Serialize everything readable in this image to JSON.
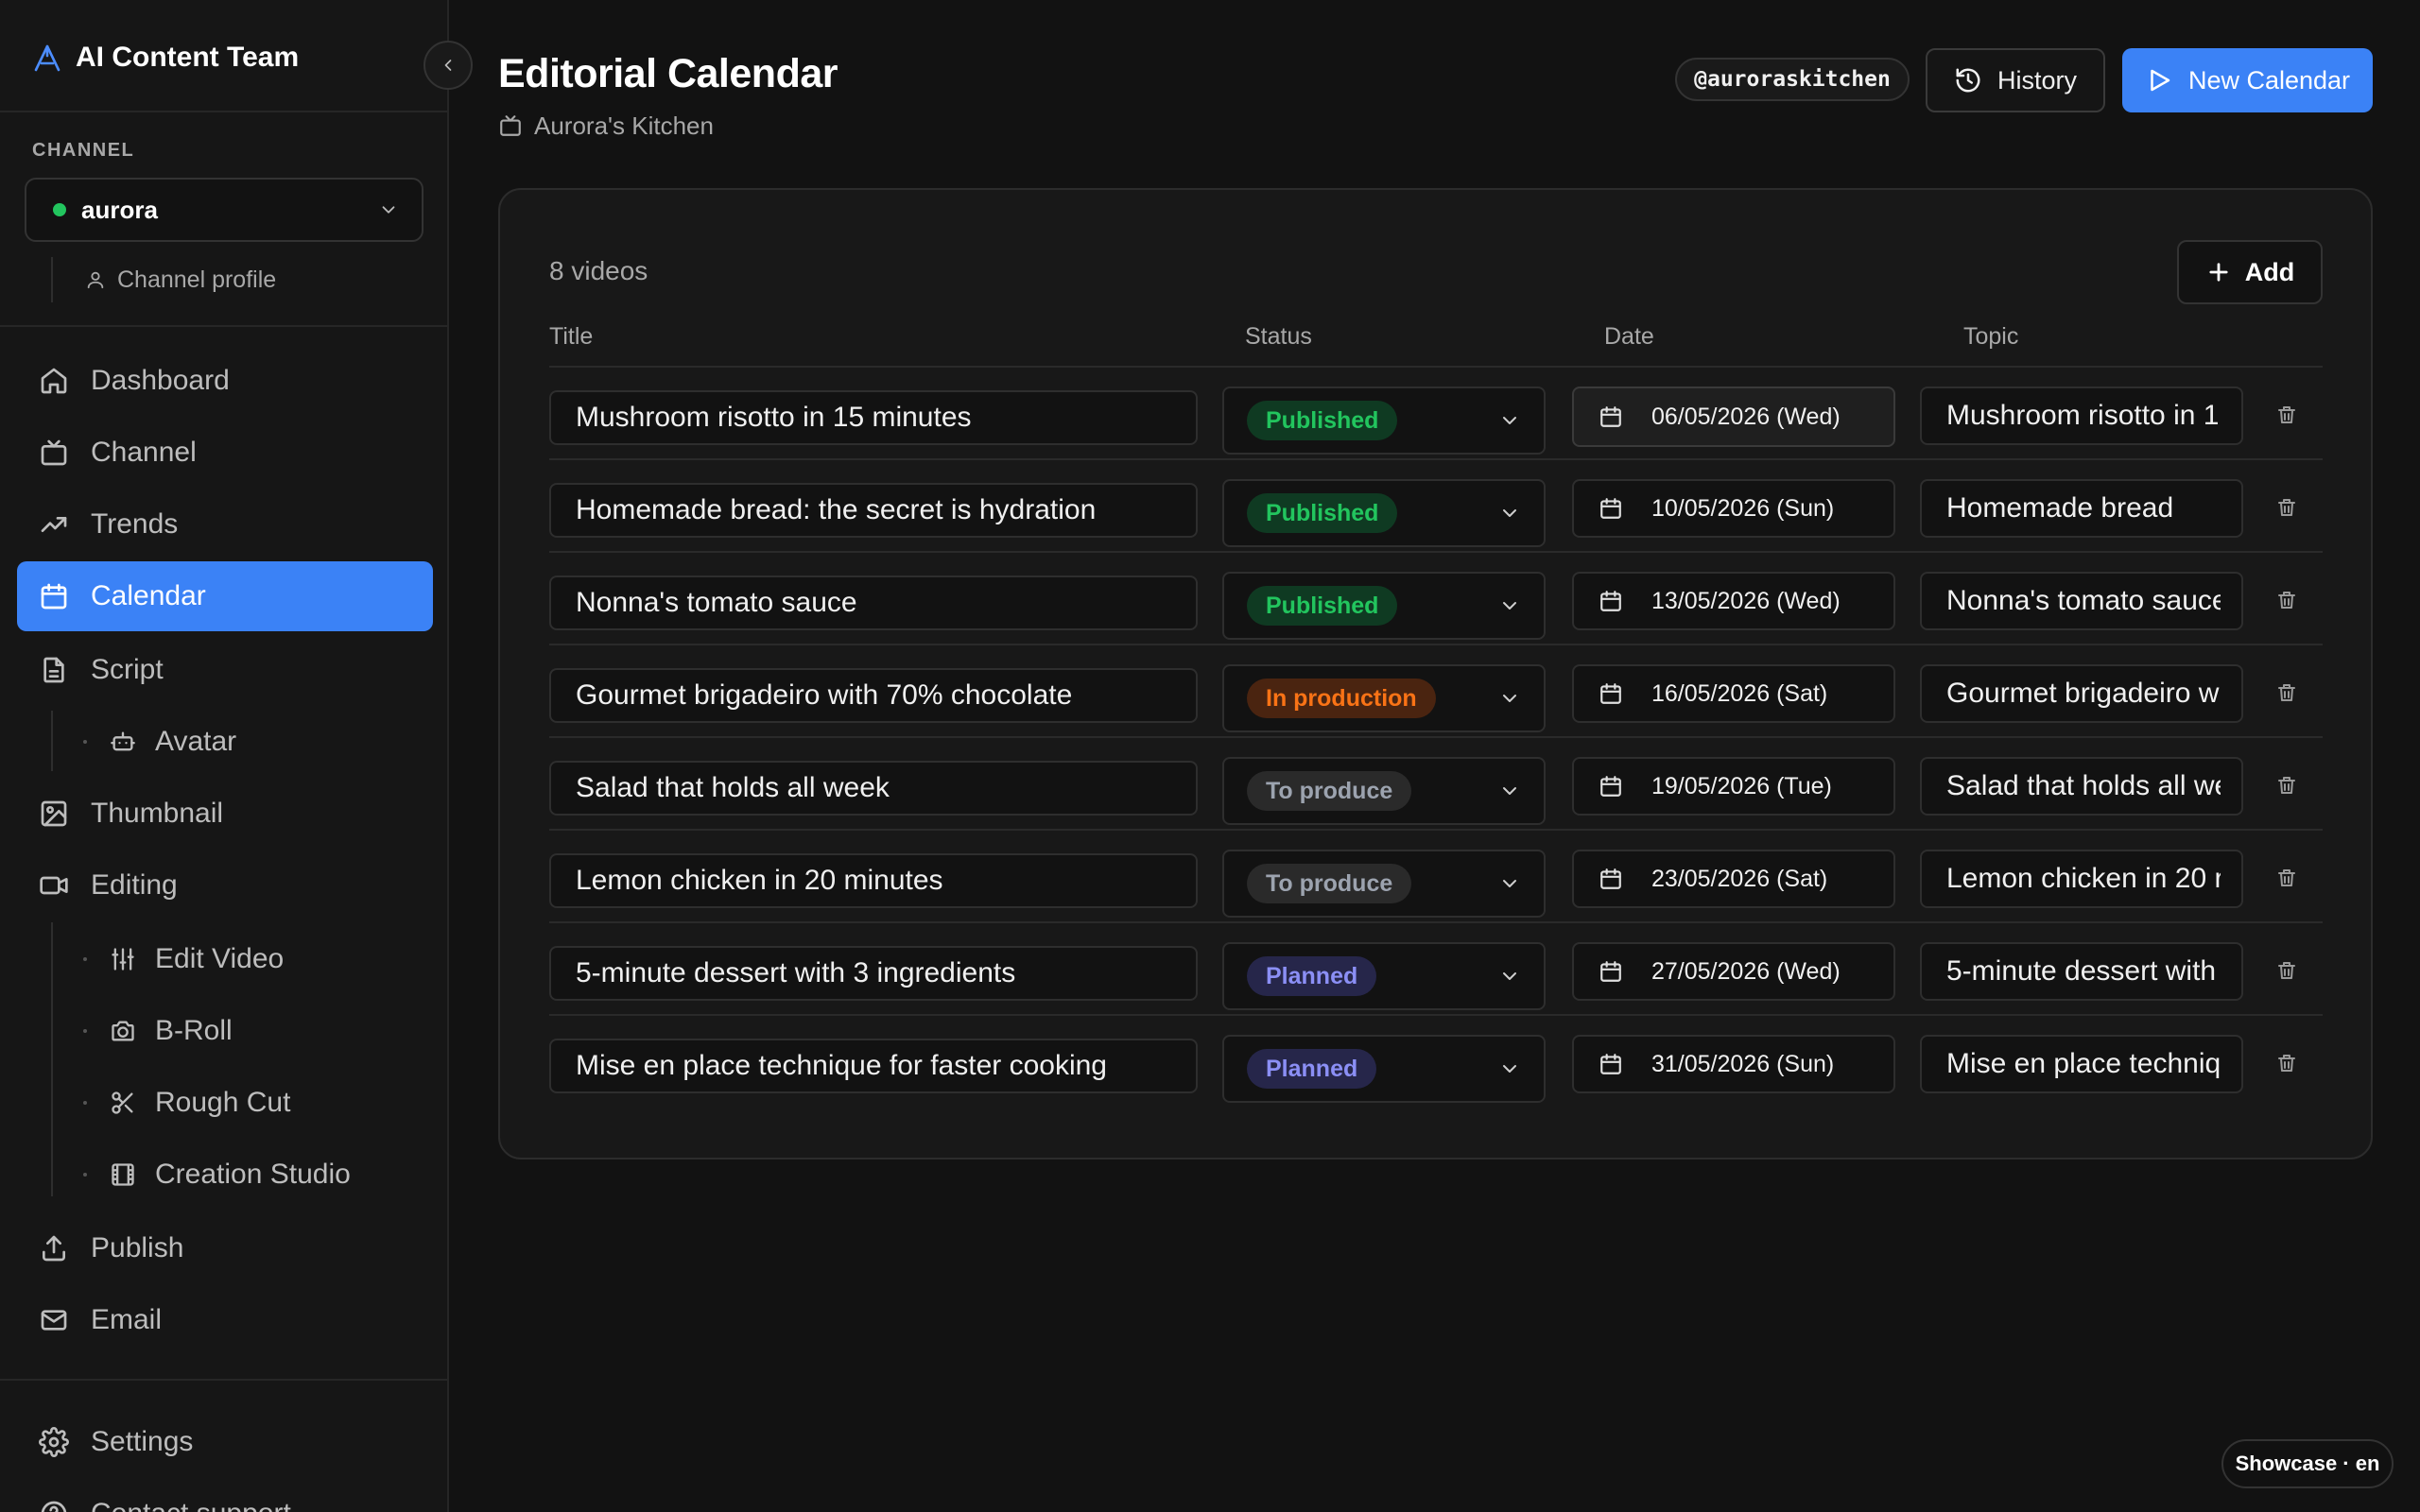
{
  "app": {
    "name": "AI Content Team"
  },
  "sidebar": {
    "channel_label": "CHANNEL",
    "channel_selected": "aurora",
    "channel_status_color": "#22c55e",
    "channel_profile": "Channel profile",
    "nav": {
      "dashboard": "Dashboard",
      "channel": "Channel",
      "trends": "Trends",
      "calendar": "Calendar",
      "script": "Script",
      "avatar": "Avatar",
      "thumbnail": "Thumbnail",
      "editing": "Editing",
      "edit_video": "Edit Video",
      "b_roll": "B-Roll",
      "rough_cut": "Rough Cut",
      "creation_studio": "Creation Studio",
      "publish": "Publish",
      "email": "Email",
      "settings": "Settings",
      "contact_support": "Contact support"
    },
    "active_item": "Calendar"
  },
  "header": {
    "title": "Editorial Calendar",
    "subtitle": "Aurora's Kitchen",
    "handle": "@auroraskitchen",
    "history_label": "History",
    "new_calendar_label": "New Calendar"
  },
  "calendar": {
    "count_label": "8 videos",
    "add_label": "Add",
    "columns": {
      "title": "Title",
      "status": "Status",
      "date": "Date",
      "topic": "Topic"
    },
    "rows": [
      {
        "title": "Mushroom risotto in 15 minutes",
        "status": "Published",
        "date": "06/05/2026 (Wed)",
        "topic": "Mushroom risotto in 1"
      },
      {
        "title": "Homemade bread: the secret is hydration",
        "status": "Published",
        "date": "10/05/2026 (Sun)",
        "topic": "Homemade bread"
      },
      {
        "title": "Nonna's tomato sauce",
        "status": "Published",
        "date": "13/05/2026 (Wed)",
        "topic": "Nonna's tomato sauce"
      },
      {
        "title": "Gourmet brigadeiro with 70% chocolate",
        "status": "In production",
        "date": "16/05/2026 (Sat)",
        "topic": "Gourmet brigadeiro w"
      },
      {
        "title": "Salad that holds all week",
        "status": "To produce",
        "date": "19/05/2026 (Tue)",
        "topic": "Salad that holds all we"
      },
      {
        "title": "Lemon chicken in 20 minutes",
        "status": "To produce",
        "date": "23/05/2026 (Sat)",
        "topic": "Lemon chicken in 20 r"
      },
      {
        "title": "5-minute dessert with 3 ingredients",
        "status": "Planned",
        "date": "27/05/2026 (Wed)",
        "topic": "5-minute dessert with"
      },
      {
        "title": "Mise en place technique for faster cooking",
        "status": "Planned",
        "date": "31/05/2026 (Sun)",
        "topic": "Mise en place techniq"
      }
    ]
  },
  "status_colors": {
    "Published": {
      "text": "#22c55e",
      "bg": "#0f3a22"
    },
    "In production": {
      "text": "#f97316",
      "bg": "#4a2410"
    },
    "To produce": {
      "text": "#9ca3af",
      "bg": "#2a2a2a"
    },
    "Planned": {
      "text": "#8b8ff5",
      "bg": "#26264a"
    }
  },
  "accent_color": "#3b82f6",
  "footer": {
    "badge": "Showcase · en"
  }
}
